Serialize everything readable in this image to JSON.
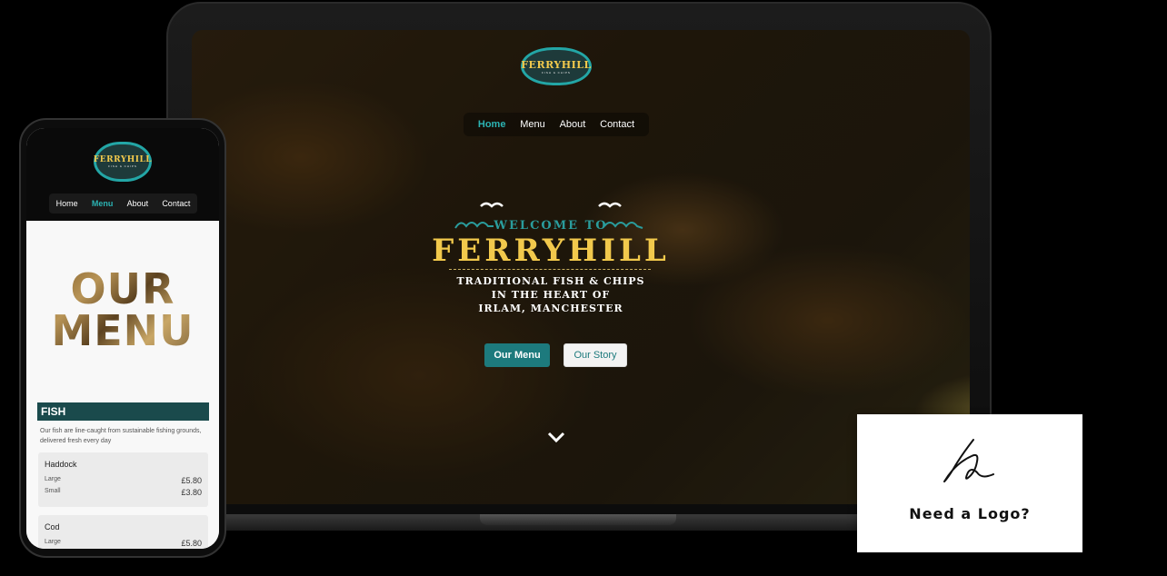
{
  "laptop": {
    "logo": {
      "title": "FERRYHILL",
      "subtitle": "FISH & CHIPS"
    },
    "nav": [
      "Home",
      "Menu",
      "About",
      "Contact"
    ],
    "active_nav": "Home",
    "hero": {
      "welcome": "WELCOME TO",
      "title": "FERRYHILL",
      "subtitle_lines": [
        "TRADITIONAL FISH & CHIPS",
        "IN THE HEART OF",
        "IRLAM, MANCHESTER"
      ]
    },
    "buttons": {
      "menu": "Our Menu",
      "story": "Our Story"
    }
  },
  "phone": {
    "logo": {
      "title": "FERRYHILL",
      "subtitle": "FISH & CHIPS"
    },
    "nav": [
      "Home",
      "Menu",
      "About",
      "Contact"
    ],
    "active_nav": "Menu",
    "headline": [
      "OUR",
      "MENU"
    ],
    "section": {
      "title": "FISH",
      "description": "Our fish are line-caught from sustainable fishing grounds, delivered fresh every day"
    },
    "items": [
      {
        "name": "Haddock",
        "sizes": [
          {
            "label": "Large",
            "price": "£5.80"
          },
          {
            "label": "Small",
            "price": "£3.80"
          }
        ]
      },
      {
        "name": "Cod",
        "sizes": [
          {
            "label": "Large",
            "price": "£5.80"
          }
        ]
      }
    ]
  },
  "promo": {
    "label": "Need a Logo?"
  },
  "colors": {
    "accent": "#1d7a7d",
    "gold": "#f2c94c",
    "teal": "#2bb3b3"
  }
}
